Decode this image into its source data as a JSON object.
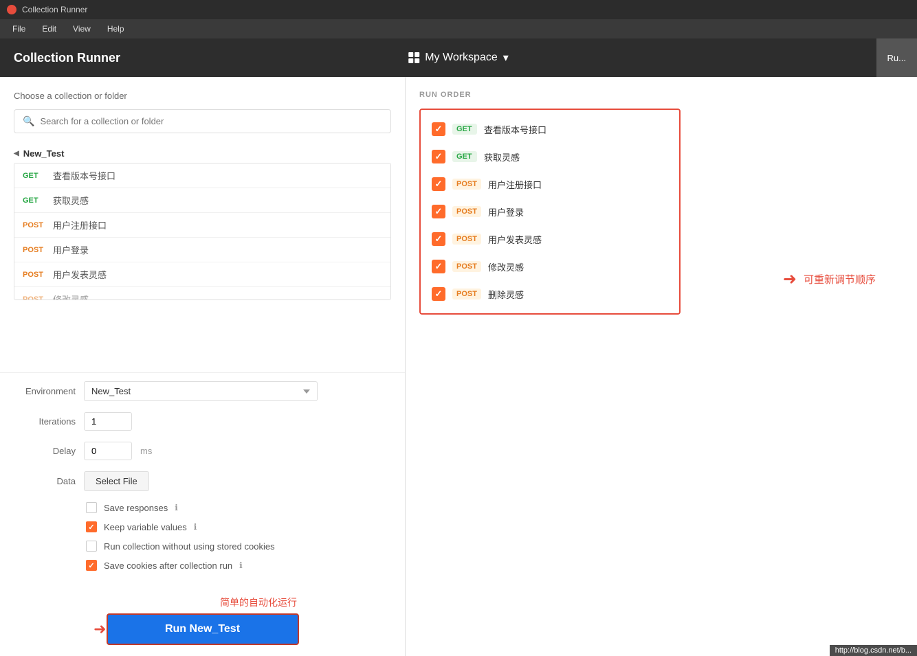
{
  "titleBar": {
    "appName": "Collection Runner"
  },
  "menuBar": {
    "items": [
      "File",
      "Edit",
      "View",
      "Help"
    ]
  },
  "header": {
    "title": "Collection Runner",
    "workspace": "My Workspace",
    "runBtn": "Ru..."
  },
  "leftPanel": {
    "chooseLabel": "Choose a collection or folder",
    "searchPlaceholder": "Search for a collection or folder",
    "collectionName": "New_Test",
    "requests": [
      {
        "method": "GET",
        "name": "查看版本号接口",
        "type": "get"
      },
      {
        "method": "GET",
        "name": "获取灵感",
        "type": "get"
      },
      {
        "method": "POST",
        "name": "用户注册接口",
        "type": "post"
      },
      {
        "method": "POST",
        "name": "用户登录",
        "type": "post"
      },
      {
        "method": "POST",
        "name": "用户发表灵感",
        "type": "post"
      },
      {
        "method": "POST",
        "name": "修改灵感",
        "type": "post",
        "faded": true
      }
    ],
    "settings": {
      "environmentLabel": "Environment",
      "environmentValue": "New_Test",
      "iterationsLabel": "Iterations",
      "iterationsValue": "1",
      "delayLabel": "Delay",
      "delayValue": "0",
      "delayUnit": "ms",
      "dataLabel": "Data",
      "selectFileBtn": "Select File"
    },
    "checkboxes": [
      {
        "id": "save-responses",
        "label": "Save responses",
        "checked": false,
        "hasInfo": true
      },
      {
        "id": "keep-variable",
        "label": "Keep variable values",
        "checked": true,
        "hasInfo": true
      },
      {
        "id": "no-cookies",
        "label": "Run collection without using stored cookies",
        "checked": false,
        "hasInfo": false
      },
      {
        "id": "save-cookies",
        "label": "Save cookies after collection run",
        "checked": true,
        "hasInfo": true
      }
    ],
    "annotationRun": "简单的自动化运行",
    "runBtn": "Run New_Test"
  },
  "rightPanel": {
    "runOrderLabel": "RUN ORDER",
    "items": [
      {
        "method": "GET",
        "name": "查看版本号接口",
        "type": "get"
      },
      {
        "method": "GET",
        "name": "获取灵感",
        "type": "get"
      },
      {
        "method": "POST",
        "name": "用户注册接口",
        "type": "post"
      },
      {
        "method": "POST",
        "name": "用户登录",
        "type": "post"
      },
      {
        "method": "POST",
        "name": "用户发表灵感",
        "type": "post"
      },
      {
        "method": "POST",
        "name": "修改灵感",
        "type": "post"
      },
      {
        "method": "POST",
        "name": "删除灵感",
        "type": "post"
      }
    ],
    "reorderAnnotation": "可重新调节顺序"
  },
  "bottomUrl": "http://blog.csdn.net/b..."
}
